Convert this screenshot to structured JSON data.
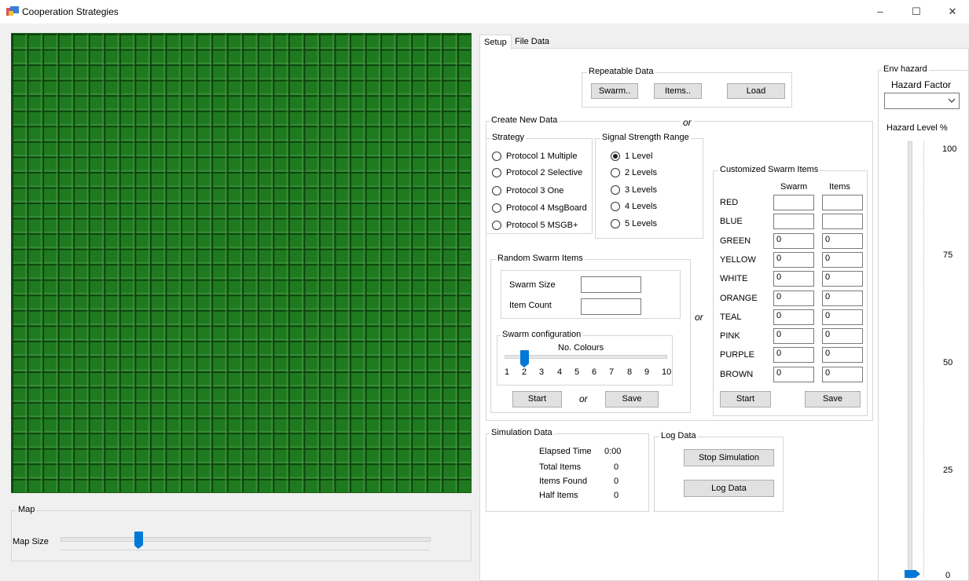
{
  "window": {
    "title": "Cooperation Strategies",
    "controls": {
      "minimize": "–",
      "maximize": "☐",
      "close": "✕"
    }
  },
  "map": {
    "group_label": "Map",
    "map_size_label": "Map Size",
    "map_size_value": 0.2
  },
  "tabs": [
    {
      "label": "Setup",
      "active": true
    },
    {
      "label": "File Data",
      "active": false
    }
  ],
  "repeatable": {
    "group_label": "Repeatable Data",
    "swarm_btn": "Swarm..",
    "items_btn": "Items..",
    "load_btn": "Load"
  },
  "or_text": "or",
  "create_new": {
    "group_label": "Create New Data",
    "strategy": {
      "group_label": "Strategy",
      "options": [
        "Protocol 1 Multiple",
        "Protocol 2 Selective",
        "Protocol 3 One",
        "Protocol 4 MsgBoard",
        "Protocol 5 MSGB+"
      ]
    },
    "signal": {
      "group_label": "Signal Strength Range",
      "options": [
        "1 Level",
        "2 Levels",
        "3 Levels",
        "4 Levels",
        "5 Levels"
      ],
      "selected": 0
    }
  },
  "random": {
    "group_label": "Random Swarm  Items",
    "swarm_size_label": "Swarm Size",
    "swarm_size_value": "",
    "item_count_label": "Item Count",
    "item_count_value": "",
    "config": {
      "group_label": "Swarm configuration",
      "slider_label": "No. Colours",
      "ticks": [
        "1",
        "2",
        "3",
        "4",
        "5",
        "6",
        "7",
        "8",
        "9",
        "10"
      ],
      "value": 2
    },
    "start_btn": "Start",
    "save_btn": "Save"
  },
  "customized": {
    "group_label": "Customized Swarm  Items",
    "col_swarm": "Swarm",
    "col_items": "Items",
    "rows": [
      {
        "color": "RED",
        "swarm": "",
        "items": ""
      },
      {
        "color": "BLUE",
        "swarm": "",
        "items": ""
      },
      {
        "color": "GREEN",
        "swarm": "0",
        "items": "0"
      },
      {
        "color": "YELLOW",
        "swarm": "0",
        "items": "0"
      },
      {
        "color": "WHITE",
        "swarm": "0",
        "items": "0"
      },
      {
        "color": "ORANGE",
        "swarm": "0",
        "items": "0"
      },
      {
        "color": "TEAL",
        "swarm": "0",
        "items": "0"
      },
      {
        "color": "PINK",
        "swarm": "0",
        "items": "0"
      },
      {
        "color": "PURPLE",
        "swarm": "0",
        "items": "0"
      },
      {
        "color": "BROWN",
        "swarm": "0",
        "items": "0"
      }
    ],
    "start_btn": "Start",
    "save_btn": "Save"
  },
  "simulation": {
    "group_label": "Simulation Data",
    "rows": [
      {
        "label": "Elapsed Time",
        "value": "0:00"
      },
      {
        "label": "Total Items",
        "value": "0"
      },
      {
        "label": "Items Found",
        "value": "0"
      },
      {
        "label": "Half Items",
        "value": "0"
      }
    ]
  },
  "log": {
    "group_label": "Log Data",
    "stop_btn": "Stop Simulation",
    "log_btn": "Log Data"
  },
  "env": {
    "group_label": "Env hazard",
    "factor_label": "Hazard Factor",
    "factor_value": "",
    "level_label": "Hazard Level %",
    "scale": [
      "100",
      "75",
      "50",
      "25",
      "0"
    ],
    "level_value": 0
  },
  "colors": {
    "grid": "#1f7a1f",
    "accent": "#0078d7"
  }
}
